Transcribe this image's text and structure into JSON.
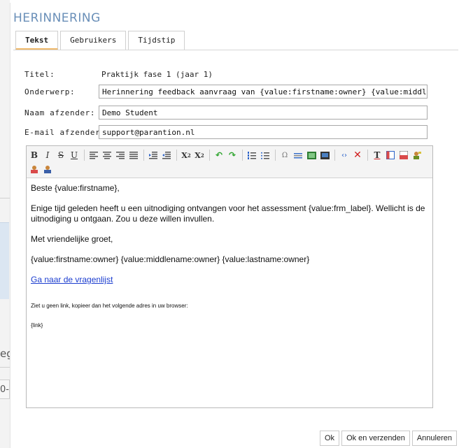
{
  "background": {
    "fragment_text_1": "eg",
    "fragment_text_2": "0-"
  },
  "dialog": {
    "title": "HERINNERING",
    "tabs": [
      {
        "label": "Tekst",
        "active": true
      },
      {
        "label": "Gebruikers",
        "active": false
      },
      {
        "label": "Tijdstip",
        "active": false
      }
    ]
  },
  "form": {
    "titel_label": "Titel:",
    "titel_value": "Praktijk fase 1 (jaar 1)",
    "onderwerp_label": "Onderwerp:",
    "onderwerp_value": "Herinnering feedback aanvraag van {value:firstname:owner} {value:middlename:ow",
    "naam_label": "Naam afzender:",
    "naam_value": "Demo Student",
    "email_label": "E-mail afzender:",
    "email_value": "support@parantion.nl"
  },
  "editor": {
    "toolbar_icons": [
      "bold-icon",
      "italic-icon",
      "strikethrough-icon",
      "underline-icon",
      "align-left-icon",
      "align-center-icon",
      "align-right-icon",
      "align-justify-icon",
      "outdent-icon",
      "indent-icon",
      "subscript-icon",
      "superscript-icon",
      "undo-icon",
      "redo-icon",
      "ordered-list-icon",
      "bullet-list-icon",
      "special-char-icon",
      "horizontal-rule-icon",
      "image-icon",
      "media-icon",
      "source-code-icon",
      "remove-format-icon",
      "text-color-icon",
      "table-icon",
      "insert-field-icon",
      "insert-user-icon",
      "insert-variable-icon",
      "insert-person-icon"
    ],
    "content": {
      "greeting": "Beste {value:firstname},",
      "body": "Enige tijd geleden heeft u een uitnodiging ontvangen voor het assessment {value:frm_label}. Wellicht is de uitnodiging u ontgaan. Zou u deze willen invullen.",
      "closing": "Met vriendelijke groet,",
      "signature": "{value:firstname:owner} {value:middlename:owner} {value:lastname:owner}",
      "link_text": "Ga naar de vragenlijst",
      "fallback_text": "Ziet u geen link, kopieer dan het volgende adres in uw browser:",
      "link_placeholder": "{link}"
    }
  },
  "footer": {
    "ok_label": "Ok",
    "ok_send_label": "Ok en verzenden",
    "cancel_label": "Annuleren"
  }
}
